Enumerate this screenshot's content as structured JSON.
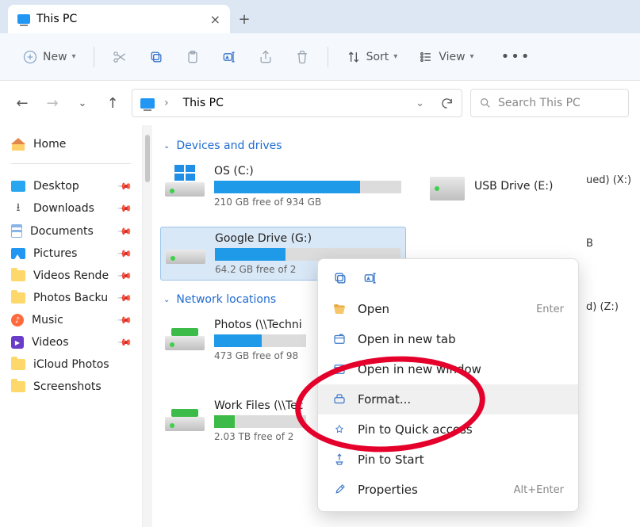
{
  "tab": {
    "title": "This PC"
  },
  "toolbar": {
    "new": "New",
    "sort": "Sort",
    "view": "View"
  },
  "address": {
    "location": "This PC"
  },
  "search": {
    "placeholder": "Search This PC"
  },
  "sidebar": {
    "home": "Home",
    "items": [
      {
        "label": "Desktop",
        "icon": "blue"
      },
      {
        "label": "Downloads",
        "icon": "dl"
      },
      {
        "label": "Documents",
        "icon": "doc"
      },
      {
        "label": "Pictures",
        "icon": "pic"
      },
      {
        "label": "Videos Rende",
        "icon": "folder"
      },
      {
        "label": "Photos Backu",
        "icon": "folder"
      },
      {
        "label": "Music",
        "icon": "music"
      },
      {
        "label": "Videos",
        "icon": "vid"
      },
      {
        "label": "iCloud Photos",
        "icon": "folder"
      },
      {
        "label": "Screenshots",
        "icon": "folder"
      }
    ]
  },
  "sections": {
    "devices": "Devices and drives",
    "network": "Network locations"
  },
  "drives": {
    "os": {
      "name": "OS (C:)",
      "free": "210 GB free of 934 GB",
      "fill_pct": 78
    },
    "usb": {
      "name": "USB Drive (E:)"
    },
    "gdrive": {
      "name": "Google Drive (G:)",
      "free": "64.2 GB free of 2",
      "fill_pct": 38
    },
    "photos": {
      "name": "Photos (\\\\Techni",
      "free": "473 GB free of 98",
      "fill_pct": 52
    },
    "work": {
      "name": "Work Files (\\\\Tec",
      "free": "2.03 TB free of 2",
      "fill_pct": 22
    }
  },
  "rightstubs": {
    "x": "ued) (X:)",
    "b": "B",
    "z": "d) (Z:)"
  },
  "ctx": {
    "open": "Open",
    "open_kbd": "Enter",
    "open_tab": "Open in new tab",
    "open_win": "Open in new window",
    "format": "Format...",
    "pin_qa": "Pin to Quick access",
    "pin_start": "Pin to Start",
    "properties": "Properties",
    "properties_kbd": "Alt+Enter"
  }
}
